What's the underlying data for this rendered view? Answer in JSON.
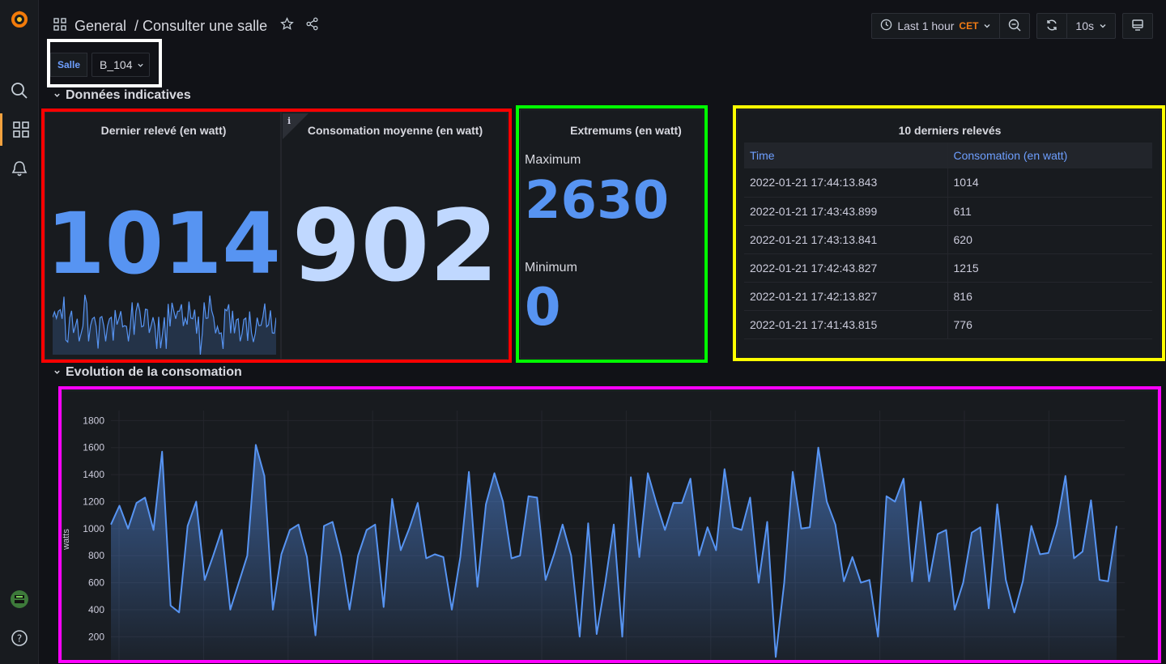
{
  "nav": {
    "logo": "grafana-logo-icon",
    "items": [
      "search-icon",
      "dashboards-icon",
      "alerting-icon"
    ],
    "bottom": [
      "user-avatar-icon",
      "help-icon"
    ]
  },
  "header": {
    "folder": "General",
    "title": "/ Consulter une salle",
    "time_range": "Last 1 hour",
    "timezone": "CET",
    "refresh": "10s"
  },
  "variables": {
    "label": "Salle",
    "value": "B_104"
  },
  "rows": [
    {
      "title": "Données indicatives"
    },
    {
      "title": "Evolution de la consomation"
    }
  ],
  "stats": {
    "last": {
      "title": "Dernier relevé (en watt)",
      "value": "1014"
    },
    "avg": {
      "title": "Consomation moyenne (en watt)",
      "value": "902",
      "info": "i"
    },
    "extremes": {
      "title": "Extremums (en watt)",
      "max_label": "Maximum",
      "max_value": "2630",
      "min_label": "Minimum",
      "min_value": "0"
    }
  },
  "table": {
    "title": "10 derniers relevés",
    "columns": [
      "Time",
      "Consomation (en watt)"
    ],
    "rows": [
      [
        "2022-01-21 17:44:13.843",
        "1014"
      ],
      [
        "2022-01-21 17:43:43.899",
        "611"
      ],
      [
        "2022-01-21 17:43:13.841",
        "620"
      ],
      [
        "2022-01-21 17:42:43.827",
        "1215"
      ],
      [
        "2022-01-21 17:42:13.827",
        "816"
      ],
      [
        "2022-01-21 17:41:43.815",
        "776"
      ]
    ]
  },
  "colors": {
    "accent": "#5794f2",
    "avg_value": "#c0d8ff",
    "frame_red": "#ff0000",
    "frame_green": "#00ff00",
    "frame_yellow": "#ffff00",
    "frame_magenta": "#ff00ff",
    "frame_white": "#ffffff"
  },
  "chart_data": {
    "type": "area",
    "title": "",
    "xlabel": "",
    "ylabel": "watts",
    "ylim": [
      100,
      1850
    ],
    "y_ticks": [
      200,
      400,
      600,
      800,
      1000,
      1200,
      1400,
      1600,
      1800
    ],
    "grid": true,
    "series": [
      {
        "values": [
          1030,
          1170,
          1000,
          1190,
          1230,
          990,
          1570,
          430,
          380,
          1020,
          1200,
          620,
          800,
          990,
          400,
          600,
          800,
          1620,
          1390,
          400,
          810,
          990,
          1030,
          790,
          210,
          1020,
          1050,
          800,
          400,
          800,
          990,
          1030,
          420,
          1220,
          840,
          1000,
          1190,
          780,
          810,
          790,
          400,
          790,
          1420,
          570,
          1180,
          1410,
          1200,
          780,
          800,
          1240,
          1230,
          620,
          810,
          1030,
          800,
          200,
          1040,
          220,
          600,
          1030,
          200,
          1380,
          790,
          1410,
          1190,
          990,
          1190,
          1190,
          1370,
          800,
          1010,
          840,
          1440,
          1010,
          990,
          1230,
          600,
          1050,
          50,
          600,
          1420,
          1000,
          1010,
          1600,
          1200,
          1030,
          610,
          790,
          600,
          620,
          200,
          1240,
          1200,
          1370,
          610,
          1200,
          610,
          960,
          990,
          400,
          600,
          970,
          1010,
          410,
          1180,
          620,
          380,
          610,
          1020,
          810,
          820,
          1030,
          1390,
          780,
          830,
          1210,
          620,
          610,
          1020
        ]
      }
    ]
  }
}
